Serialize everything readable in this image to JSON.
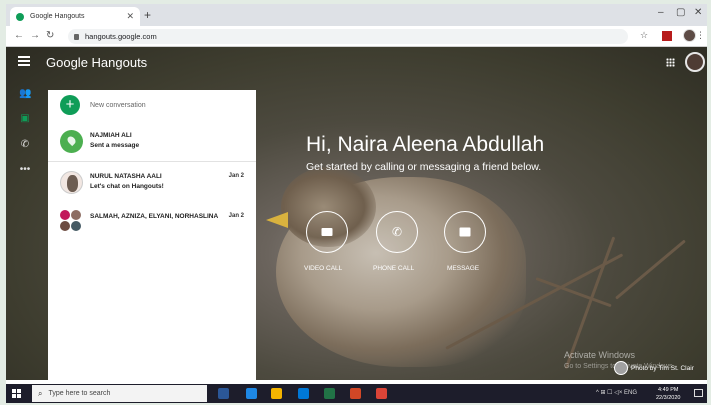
{
  "browser": {
    "tab_title": "Google Hangouts",
    "tab_close": "✕",
    "new_tab": "+",
    "url": "hangouts.google.com",
    "window_minimize": "–",
    "window_maximize": "▢",
    "window_close": "✕",
    "menu": "⋮"
  },
  "app": {
    "brand": "Google Hangouts",
    "new_conversation": "New conversation",
    "conversations": [
      {
        "name": "NAJMIAH ALI",
        "message": "Sent a message",
        "date": ""
      },
      {
        "name": "NURUL NATASHA AALI",
        "message": "Let's chat on Hangouts!",
        "date": "Jan 2"
      },
      {
        "name": "SALMAH, AZNIZA, ELYANI, NORHASLINA",
        "message": "",
        "date": "Jan 2"
      }
    ],
    "greeting": "Hi, Naira Aleena Abdullah",
    "subtitle": "Get started by calling or messaging a friend below.",
    "actions": {
      "video_call": "VIDEO CALL",
      "phone_call": "PHONE CALL",
      "message": "MESSAGE"
    },
    "activate_title": "Activate Windows",
    "activate_sub": "Go to Settings to activate Windows.",
    "photo_credit": "Photo by Tim St. Clair"
  },
  "taskbar": {
    "search_placeholder": "Type here to search",
    "tray": "^  ⊞  ☐  ◁×  ENG",
    "time": "4:49 PM",
    "date": "22/3/2020",
    "app_colors": [
      "#2b5797",
      "#1e88e5",
      "#f4b400",
      "#0078d7",
      "#217346",
      "#d24726",
      "#db4437"
    ]
  },
  "colors": {
    "hangouts_green": "#0f9d58",
    "taskbar": "#1d1d2b"
  }
}
